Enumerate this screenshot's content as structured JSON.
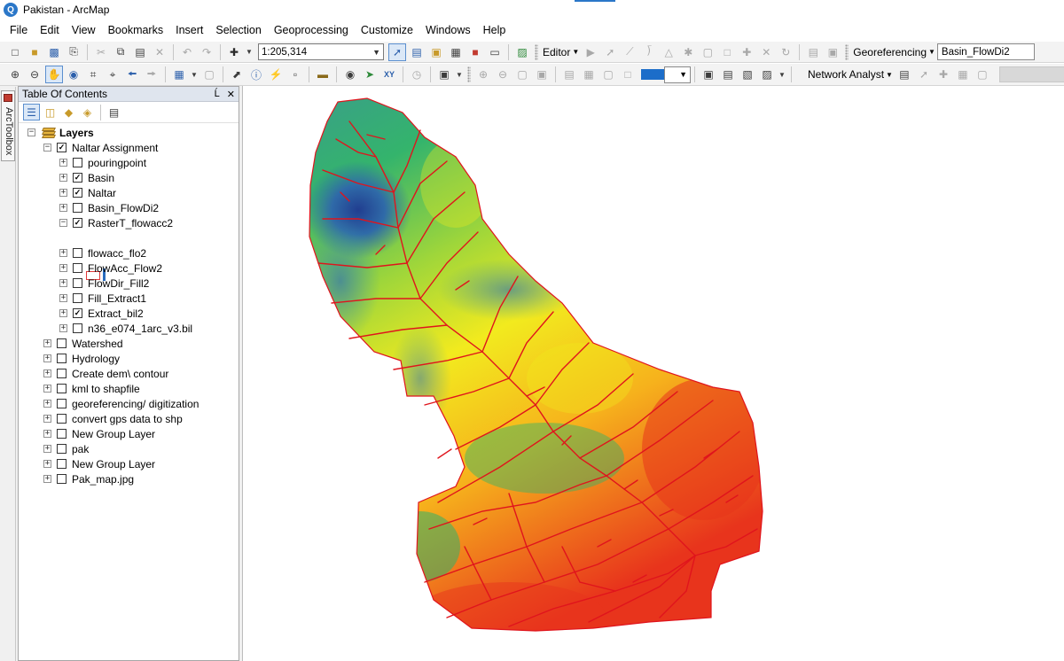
{
  "window": {
    "title": "Pakistan - ArcMap"
  },
  "menu": [
    "File",
    "Edit",
    "View",
    "Bookmarks",
    "Insert",
    "Selection",
    "Geoprocessing",
    "Customize",
    "Windows",
    "Help"
  ],
  "toolbar": {
    "scale": "1:205,314",
    "editor_label": "Editor",
    "georeferencing_label": "Georeferencing",
    "georeferencing_layer": "Basin_FlowDi2",
    "network_analyst_label": "Network Analyst"
  },
  "arctoolbox": {
    "label": "ArcToolbox"
  },
  "toc": {
    "title": "Table Of Contents",
    "pin": "Ĺ",
    "close": "✕",
    "root": "Layers",
    "tree": [
      {
        "label": "Naltar Assignment",
        "checked": true,
        "expanded": true
      },
      {
        "label": "pouringpoint",
        "checked": false,
        "expanded": false
      },
      {
        "label": "Basin",
        "checked": true,
        "expanded": false
      },
      {
        "label": "Naltar",
        "checked": true,
        "expanded": false
      },
      {
        "label": "Basin_FlowDi2",
        "checked": false,
        "expanded": false
      },
      {
        "label": "RasterT_flowacc2",
        "checked": true,
        "expanded": true
      },
      {
        "label": "flowacc_flo2",
        "checked": false,
        "expanded": false
      },
      {
        "label": "FlowAcc_Flow2",
        "checked": false,
        "expanded": false
      },
      {
        "label": "FlowDir_Fill2",
        "checked": false,
        "expanded": false
      },
      {
        "label": "Fill_Extract1",
        "checked": false,
        "expanded": false
      },
      {
        "label": "Extract_bil2",
        "checked": true,
        "expanded": false
      },
      {
        "label": "n36_e074_1arc_v3.bil",
        "checked": false,
        "expanded": false
      },
      {
        "label": "Watershed",
        "checked": false,
        "expanded": false
      },
      {
        "label": "Hydrology",
        "checked": false,
        "expanded": false
      },
      {
        "label": "Create dem\\ contour",
        "checked": false,
        "expanded": false
      },
      {
        "label": "kml to shapfile",
        "checked": false,
        "expanded": false
      },
      {
        "label": "georeferencing/ digitization",
        "checked": false,
        "expanded": false
      },
      {
        "label": "convert gps data to shp",
        "checked": false,
        "expanded": false
      },
      {
        "label": "New Group Layer",
        "checked": false,
        "expanded": false
      },
      {
        "label": "pak",
        "checked": false,
        "expanded": false
      },
      {
        "label": "New Group Layer",
        "checked": false,
        "expanded": false
      },
      {
        "label": "Pak_map.jpg",
        "checked": false,
        "expanded": false
      }
    ]
  },
  "icons": {
    "check": "✓",
    "expanded": "−",
    "collapsed": "+"
  },
  "colors": {
    "stream": "#e0141c",
    "dem_low": "#2d4ea0",
    "dem_mid": "#2fb36a",
    "dem_high": "#f5e81a",
    "dem_top": "#e8341c"
  }
}
